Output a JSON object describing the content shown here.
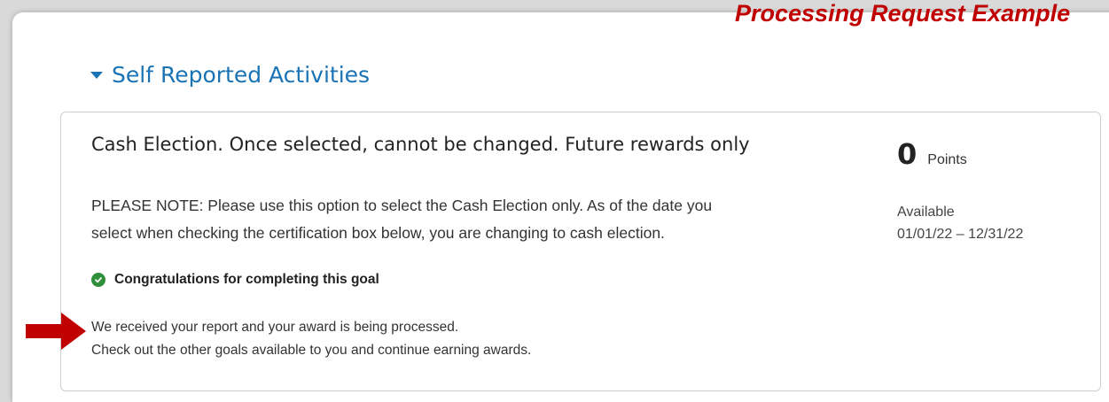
{
  "overlay": {
    "title": "Processing Request Example"
  },
  "section": {
    "title": "Self Reported Activities",
    "caret_icon": "caret-down-icon"
  },
  "activity": {
    "title": "Cash Election. Once selected, cannot be changed. Future rewards only",
    "description_line1": "PLEASE NOTE: Please use this option to select the Cash Election only. As of the date you",
    "description_line2": "select when checking the certification box below, you are changing to cash election.",
    "points": {
      "value": "0",
      "unit": "Points"
    },
    "availability": {
      "label": "Available",
      "dates": "01/01/22 – 12/31/22"
    },
    "status": {
      "icon": "check-circle-icon",
      "text": "Congratulations for completing this goal",
      "color": "#2f8f3a"
    },
    "message_line1": "We received your report and your award is being processed.",
    "message_line2": "Check out the other goals available to you and continue earning awards."
  },
  "colors": {
    "accent": "#1a73b5",
    "annotation": "#c00000"
  }
}
